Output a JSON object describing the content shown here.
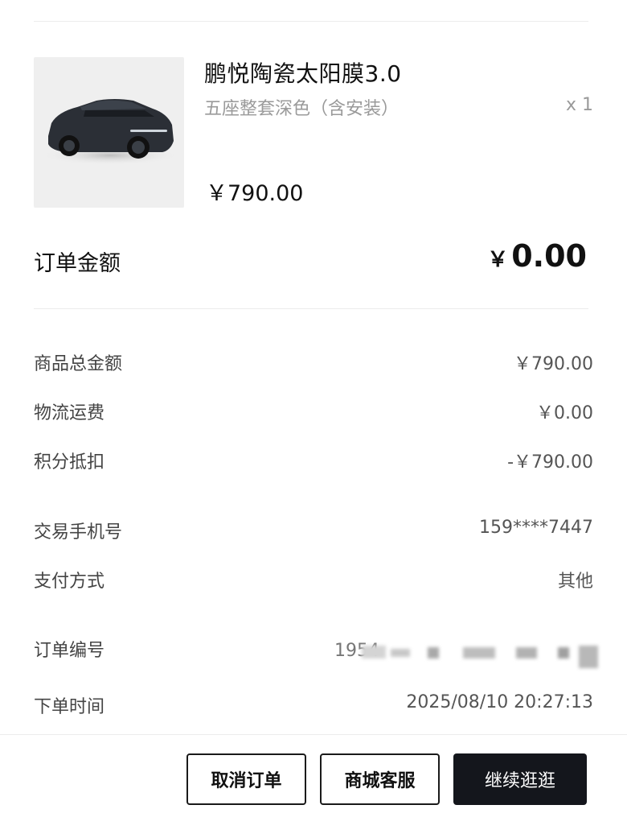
{
  "product": {
    "name": "鹏悦陶瓷太阳膜3.0",
    "variant": "五座整套深色（含安装）",
    "quantity": "x 1",
    "price": "￥790.00",
    "image_icon": "car-photo"
  },
  "order_total": {
    "label": "订单金额",
    "currency": "￥",
    "amount": "0.00"
  },
  "summary": {
    "goods_total_label": "商品总金额",
    "goods_total_value": "￥790.00",
    "shipping_label": "物流运费",
    "shipping_value": "￥0.00",
    "points_label": "积分抵扣",
    "points_value": "-￥790.00"
  },
  "details": {
    "phone_label": "交易手机号",
    "phone_value": "159****7447",
    "payment_label": "支付方式",
    "payment_value": "其他",
    "order_no_label": "订单编号",
    "order_no_value": "1954",
    "time_label": "下单时间",
    "time_value": "2025/08/10 20:27:13"
  },
  "actions": {
    "cancel_label": "取消订单",
    "service_label": "商城客服",
    "continue_label": "继续逛逛"
  },
  "colors": {
    "primary_dark": "#14161c",
    "muted_text": "#9a9a9a"
  }
}
